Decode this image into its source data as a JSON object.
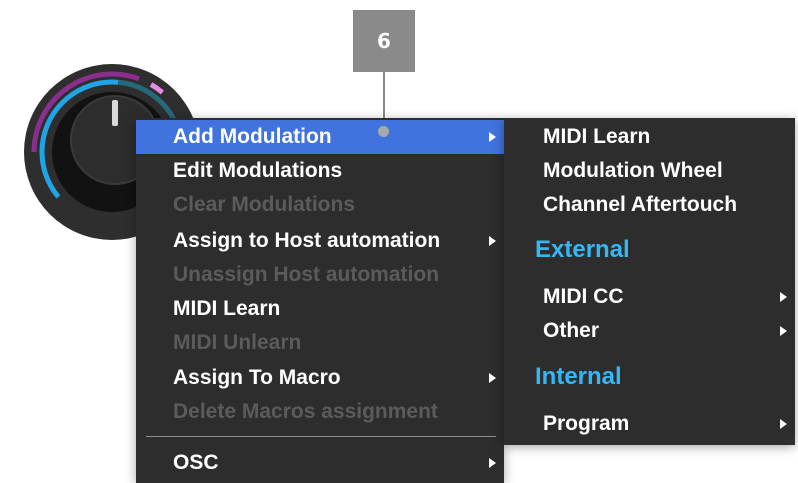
{
  "callout": {
    "number": "6"
  },
  "knob": {
    "name": "parameter-knob"
  },
  "context_menu": {
    "items": [
      {
        "label": "Add Modulation",
        "enabled": true,
        "highlighted": true,
        "has_submenu": true
      },
      {
        "label": "Edit Modulations",
        "enabled": true,
        "highlighted": false,
        "has_submenu": false
      },
      {
        "label": "Clear Modulations",
        "enabled": false,
        "highlighted": false,
        "has_submenu": false
      },
      {
        "label": "Assign to Host automation",
        "enabled": true,
        "highlighted": false,
        "has_submenu": true
      },
      {
        "label": "Unassign Host automation",
        "enabled": false,
        "highlighted": false,
        "has_submenu": false
      },
      {
        "label": "MIDI Learn",
        "enabled": true,
        "highlighted": false,
        "has_submenu": false
      },
      {
        "label": "MIDI Unlearn",
        "enabled": false,
        "highlighted": false,
        "has_submenu": false
      },
      {
        "label": "Assign To Macro",
        "enabled": true,
        "highlighted": false,
        "has_submenu": true
      },
      {
        "label": "Delete Macros assignment",
        "enabled": false,
        "highlighted": false,
        "has_submenu": false
      },
      {
        "label": "OSC",
        "enabled": true,
        "highlighted": false,
        "has_submenu": true
      }
    ]
  },
  "submenu": {
    "items": [
      {
        "label": "MIDI Learn",
        "has_submenu": false
      },
      {
        "label": "Modulation Wheel",
        "has_submenu": false
      },
      {
        "label": "Channel Aftertouch",
        "has_submenu": false
      }
    ],
    "sections": [
      {
        "header": "External",
        "items": [
          {
            "label": "MIDI CC",
            "has_submenu": true
          },
          {
            "label": "Other",
            "has_submenu": true
          }
        ]
      },
      {
        "header": "Internal",
        "items": [
          {
            "label": "Program",
            "has_submenu": true
          }
        ]
      }
    ]
  },
  "colors": {
    "menu_background": "#2d2d2d",
    "highlight": "#4173de",
    "disabled_text": "#5b5b5b",
    "section_header": "#35b6f5",
    "callout": "#8a8a8a",
    "knob_ring_purple": "#8a2f8e",
    "knob_ring_blue": "#1fa5e6",
    "knob_ring_teal": "#27697c",
    "knob_ring_pink": "#e68ae6"
  }
}
